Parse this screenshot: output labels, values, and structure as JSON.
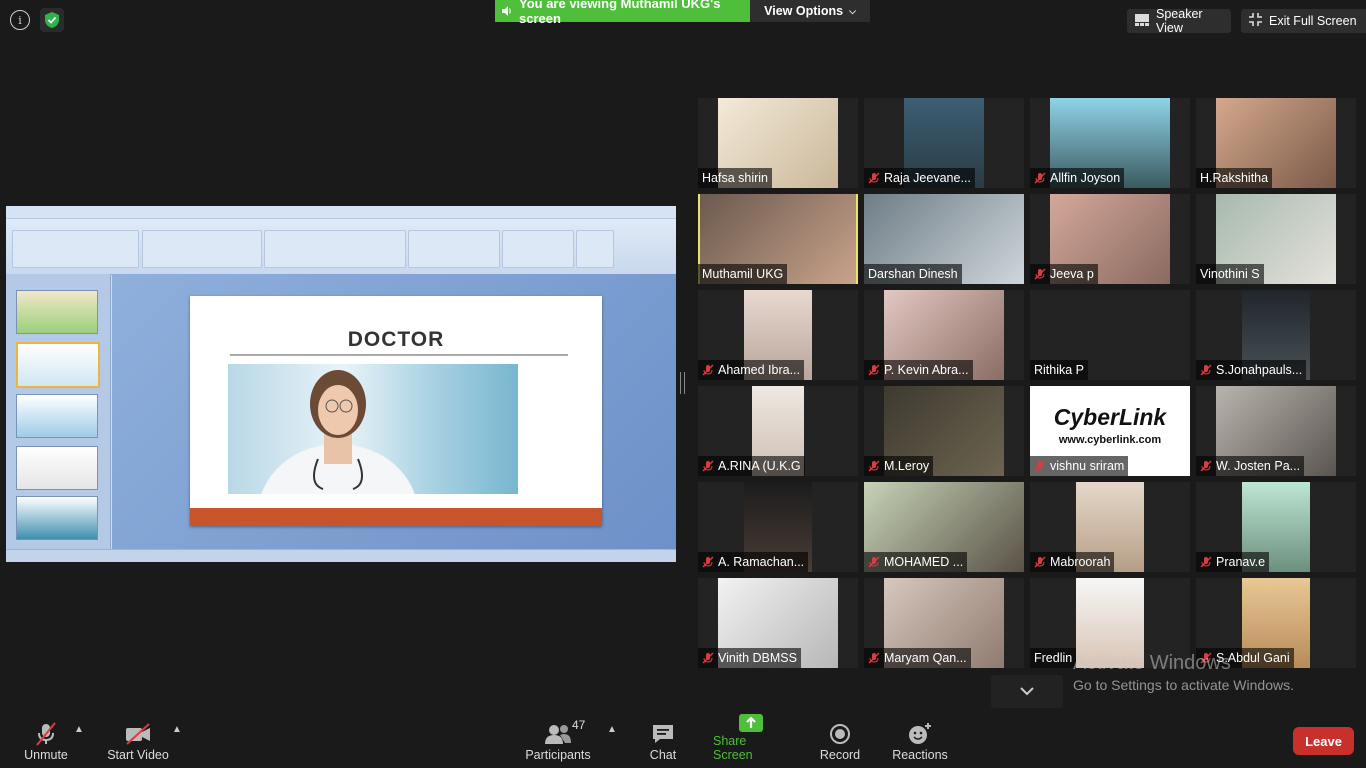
{
  "top": {
    "banner": "You are viewing Muthamil UKG's screen",
    "view_options": "View Options",
    "speaker_view": "Speaker View",
    "exit_full_screen": "Exit Full Screen"
  },
  "slide": {
    "title": "DOCTOR"
  },
  "gallery": [
    {
      "name": "Hafsa shirin",
      "muted": false
    },
    {
      "name": "Raja Jeevane...",
      "muted": true
    },
    {
      "name": "Allfin Joyson",
      "muted": true
    },
    {
      "name": "H.Rakshitha",
      "muted": false
    },
    {
      "name": "Muthamil UKG",
      "muted": false,
      "active": true
    },
    {
      "name": "Darshan Dinesh",
      "muted": false
    },
    {
      "name": "Jeeva p",
      "muted": true
    },
    {
      "name": "Vinothini S",
      "muted": false
    },
    {
      "name": "Ahamed Ibra...",
      "muted": true
    },
    {
      "name": "P. Kevin Abra...",
      "muted": true
    },
    {
      "name": "Rithika P",
      "muted": false
    },
    {
      "name": "S.Jonahpauls...",
      "muted": true
    },
    {
      "name": "A.RINA (U.K.G",
      "muted": true
    },
    {
      "name": "M.Leroy",
      "muted": true
    },
    {
      "name": "vishnu sriram",
      "muted": true
    },
    {
      "name": "W. Josten Pa...",
      "muted": true
    },
    {
      "name": "A. Ramachan...",
      "muted": true
    },
    {
      "name": "MOHAMED ...",
      "muted": true
    },
    {
      "name": "Mabroorah",
      "muted": true
    },
    {
      "name": "Pranav.e",
      "muted": true
    },
    {
      "name": "Vinith DBMSS",
      "muted": true
    },
    {
      "name": "Maryam Qan...",
      "muted": true
    },
    {
      "name": "Fredlin",
      "muted": false
    },
    {
      "name": "S.Abdul Gani",
      "muted": true
    }
  ],
  "cyberlink": {
    "logo": "CyberLink",
    "url": "www.cyberlink.com"
  },
  "watermark": {
    "line1": "Activate Windows",
    "line2": "Go to Settings to activate Windows."
  },
  "toolbar": {
    "unmute": "Unmute",
    "start_video": "Start Video",
    "participants": "Participants",
    "participants_count": "47",
    "chat": "Chat",
    "share_screen": "Share Screen",
    "record": "Record",
    "reactions": "Reactions",
    "leave": "Leave"
  },
  "colors": {
    "banner_green": "#4fbe3a",
    "leave_red": "#c8302c",
    "active_speaker": "#e9e26b",
    "mute_red": "#e0393e"
  }
}
